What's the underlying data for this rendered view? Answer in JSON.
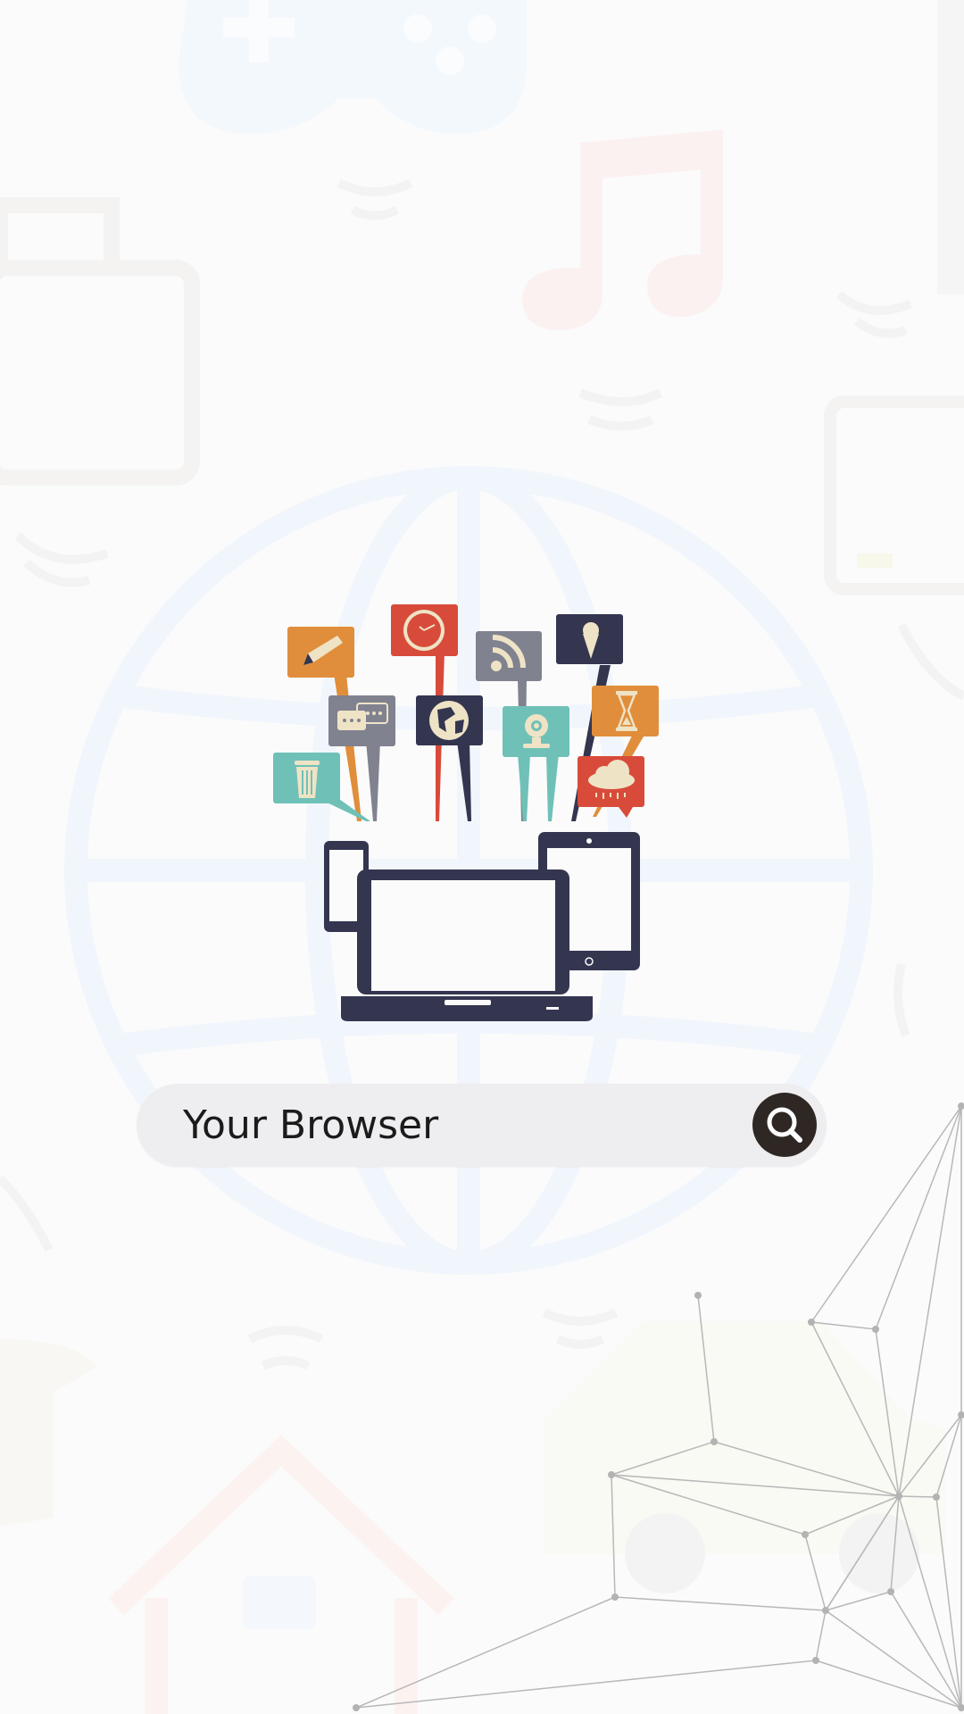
{
  "search": {
    "value": "Your Browser",
    "button_icon": "search-icon"
  },
  "illustration": {
    "icons": [
      "pencil-icon",
      "clock-icon",
      "rss-icon",
      "ice-cream-icon",
      "chat-icon",
      "globe-icon",
      "webcam-icon",
      "hourglass-icon",
      "trash-icon",
      "rain-cloud-icon",
      "smartphone-icon",
      "laptop-icon",
      "tablet-icon"
    ]
  },
  "background": {
    "icons": [
      "gamepad-icon",
      "music-note-icon",
      "boombox-icon",
      "tablet-icon",
      "globe-icon",
      "house-icon",
      "car-icon"
    ]
  },
  "colors": {
    "background": "#fbfbfc",
    "search_bar": "#eeedef",
    "search_button": "#2e2724",
    "navy": "#343650",
    "orange": "#e08e3b",
    "red": "#d84b3a",
    "teal": "#6fc1b7",
    "grey": "#80828f",
    "cream": "#efe3c6"
  }
}
